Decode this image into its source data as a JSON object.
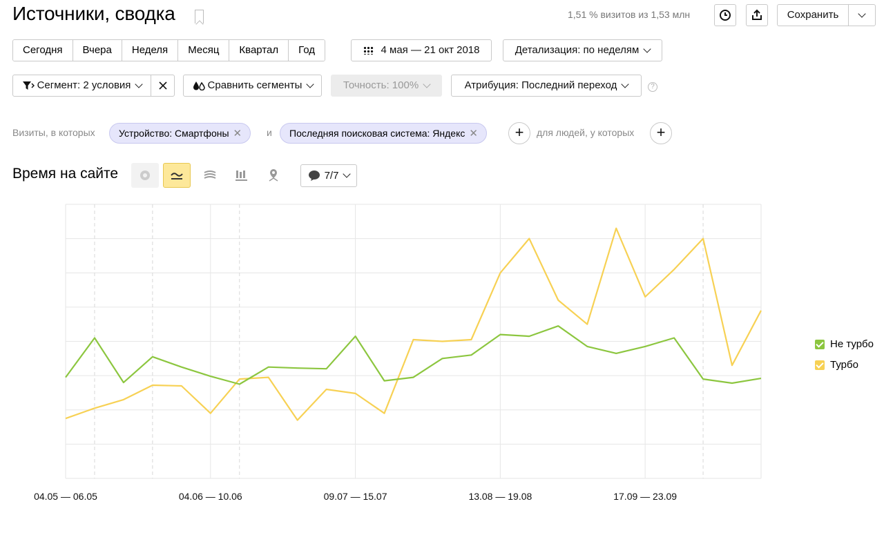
{
  "header": {
    "title": "Источники, сводка",
    "visits_note": "1,51 % визитов из 1,53 млн",
    "save_label": "Сохранить"
  },
  "periods": [
    "Сегодня",
    "Вчера",
    "Неделя",
    "Месяц",
    "Квартал",
    "Год"
  ],
  "date_range": "4 мая — 21 окт 2018",
  "detail": "Детализация: по неделям",
  "filters": {
    "segment": "Сегмент: 2 условия",
    "compare": "Сравнить сегменты",
    "accuracy": "Точность: 100%",
    "attribution": "Атрибуция: Последний переход"
  },
  "conditions": {
    "prefix": "Визиты, в которых",
    "chip1": "Устройство: Смартфоны",
    "and": "и",
    "chip2": "Последняя поисковая система: Яндекс",
    "people": "для людей, у которых"
  },
  "section": {
    "title": "Время на сайте",
    "comments": "7/7"
  },
  "chart_data": {
    "type": "line",
    "x_labels": [
      "04.05 — 06.05",
      "04.06 — 10.06",
      "09.07 — 15.07",
      "13.08 — 19.08",
      "17.09 — 23.09"
    ],
    "series": [
      {
        "name": "Не турбо",
        "color": "#8cc63f",
        "values": [
          2.95,
          4.1,
          2.8,
          3.55,
          3.25,
          2.98,
          2.75,
          3.25,
          3.22,
          3.2,
          4.15,
          2.85,
          2.95,
          3.5,
          3.6,
          4.2,
          4.15,
          4.45,
          3.85,
          3.65,
          3.85,
          4.1,
          2.9,
          2.78,
          2.92
        ]
      },
      {
        "name": "Турбо",
        "color": "#f7d154",
        "values": [
          1.75,
          2.05,
          2.3,
          2.72,
          2.7,
          1.9,
          2.9,
          2.95,
          1.7,
          2.6,
          2.48,
          1.9,
          4.05,
          4.0,
          4.05,
          6.0,
          7.0,
          5.2,
          4.5,
          7.3,
          5.3,
          6.1,
          7.0,
          3.3,
          4.9
        ]
      }
    ],
    "grid": true,
    "legend": "right"
  }
}
